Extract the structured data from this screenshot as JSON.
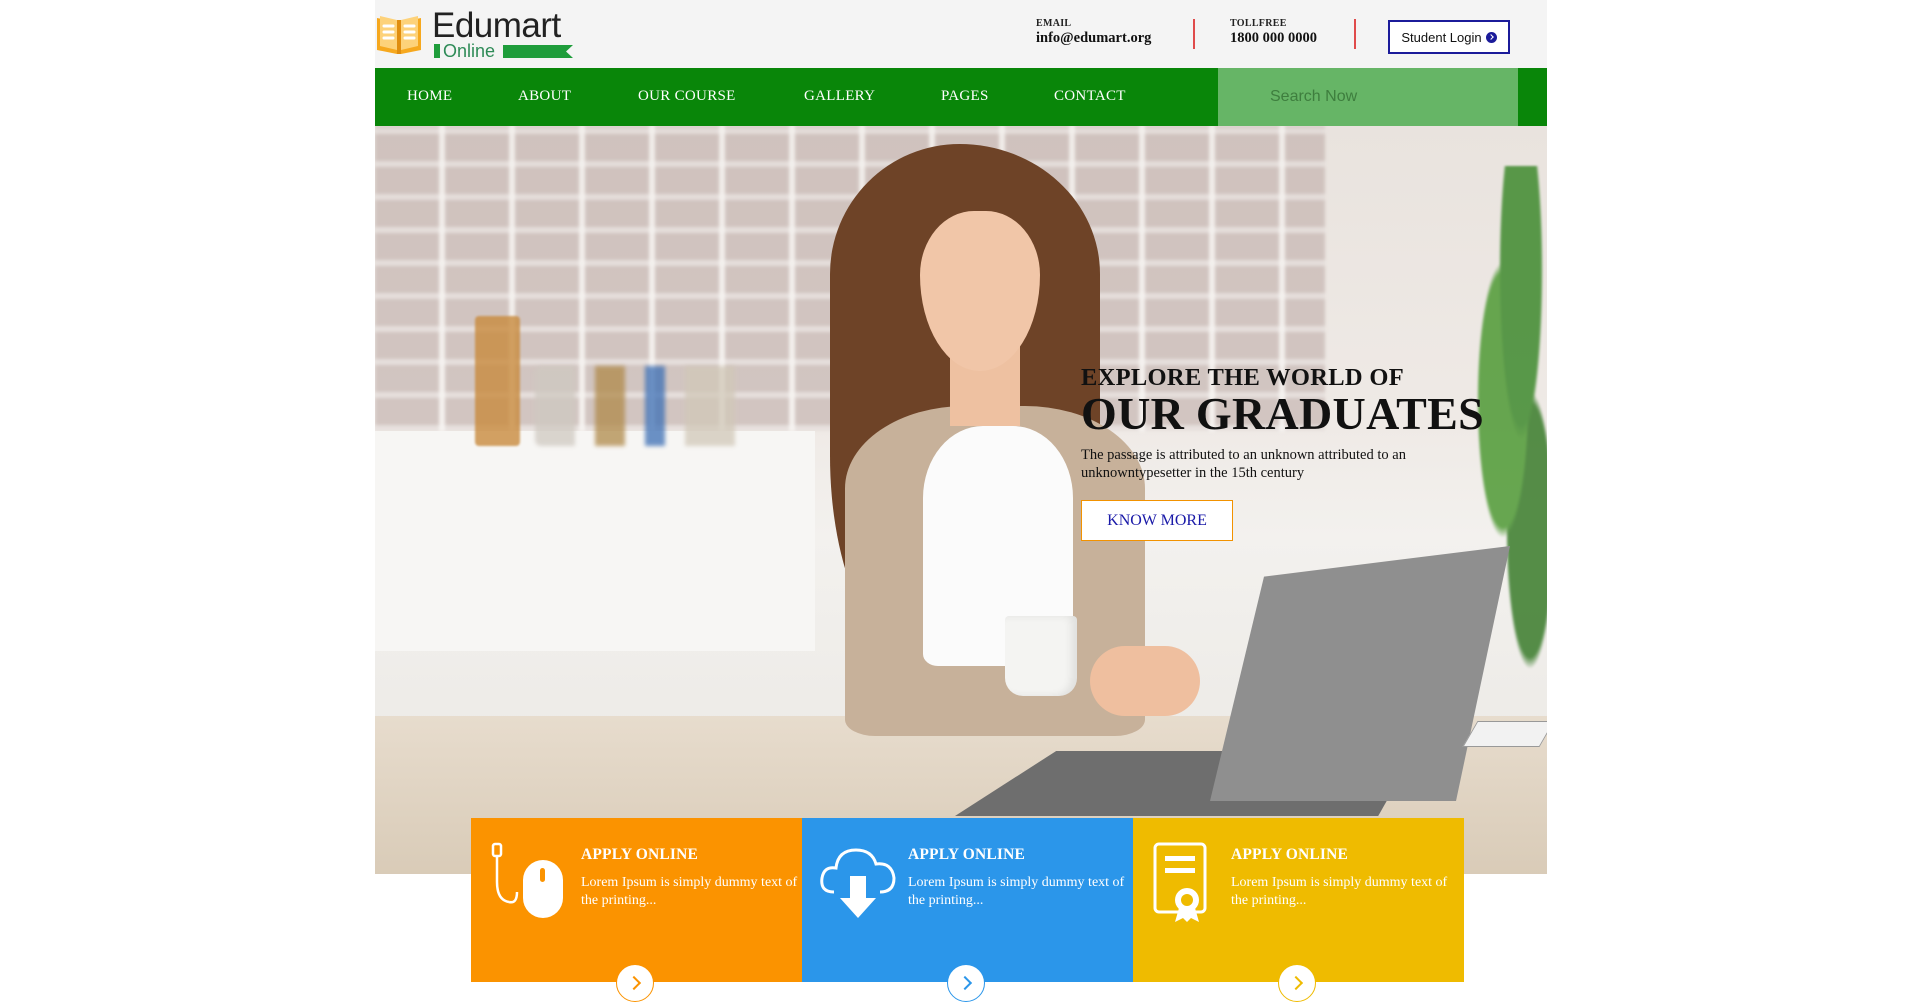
{
  "brand": {
    "name": "Edumart",
    "sub": "Online"
  },
  "contact": {
    "email_label": "EMAIL",
    "email": "info@edumart.org",
    "tollfree_label": "TOLLFREE",
    "tollfree": "1800 000 0000"
  },
  "login": {
    "label": "Student Login"
  },
  "nav": {
    "items": [
      {
        "label": "HOME"
      },
      {
        "label": "ABOUT"
      },
      {
        "label": "OUR COURSE"
      },
      {
        "label": "GALLERY"
      },
      {
        "label": "PAGES"
      },
      {
        "label": "CONTACT"
      }
    ],
    "search_placeholder": "Search Now"
  },
  "hero": {
    "kicker": "EXPLORE THE WORLD OF",
    "title": "OUR GRADUATES",
    "description": "The passage is attributed to an unknown attributed to an unknowntypesetter in the 15th century",
    "button": "KNOW MORE"
  },
  "cards": [
    {
      "title": "APPLY ONLINE",
      "text": "Lorem Ipsum is simply dummy text of the printing...",
      "icon": "mouse-icon",
      "color": "#fb9300"
    },
    {
      "title": "APPLY ONLINE",
      "text": "Lorem Ipsum is simply dummy text of the printing...",
      "icon": "cloud-download-icon",
      "color": "#2b96ea"
    },
    {
      "title": "APPLY ONLINE",
      "text": "Lorem Ipsum is simply dummy text of the printing...",
      "icon": "certificate-icon",
      "color": "#efbb00"
    }
  ],
  "colors": {
    "nav_green": "#098609",
    "search_green": "#66b566",
    "accent_orange": "#f29200",
    "login_border": "#1b1b9a"
  }
}
